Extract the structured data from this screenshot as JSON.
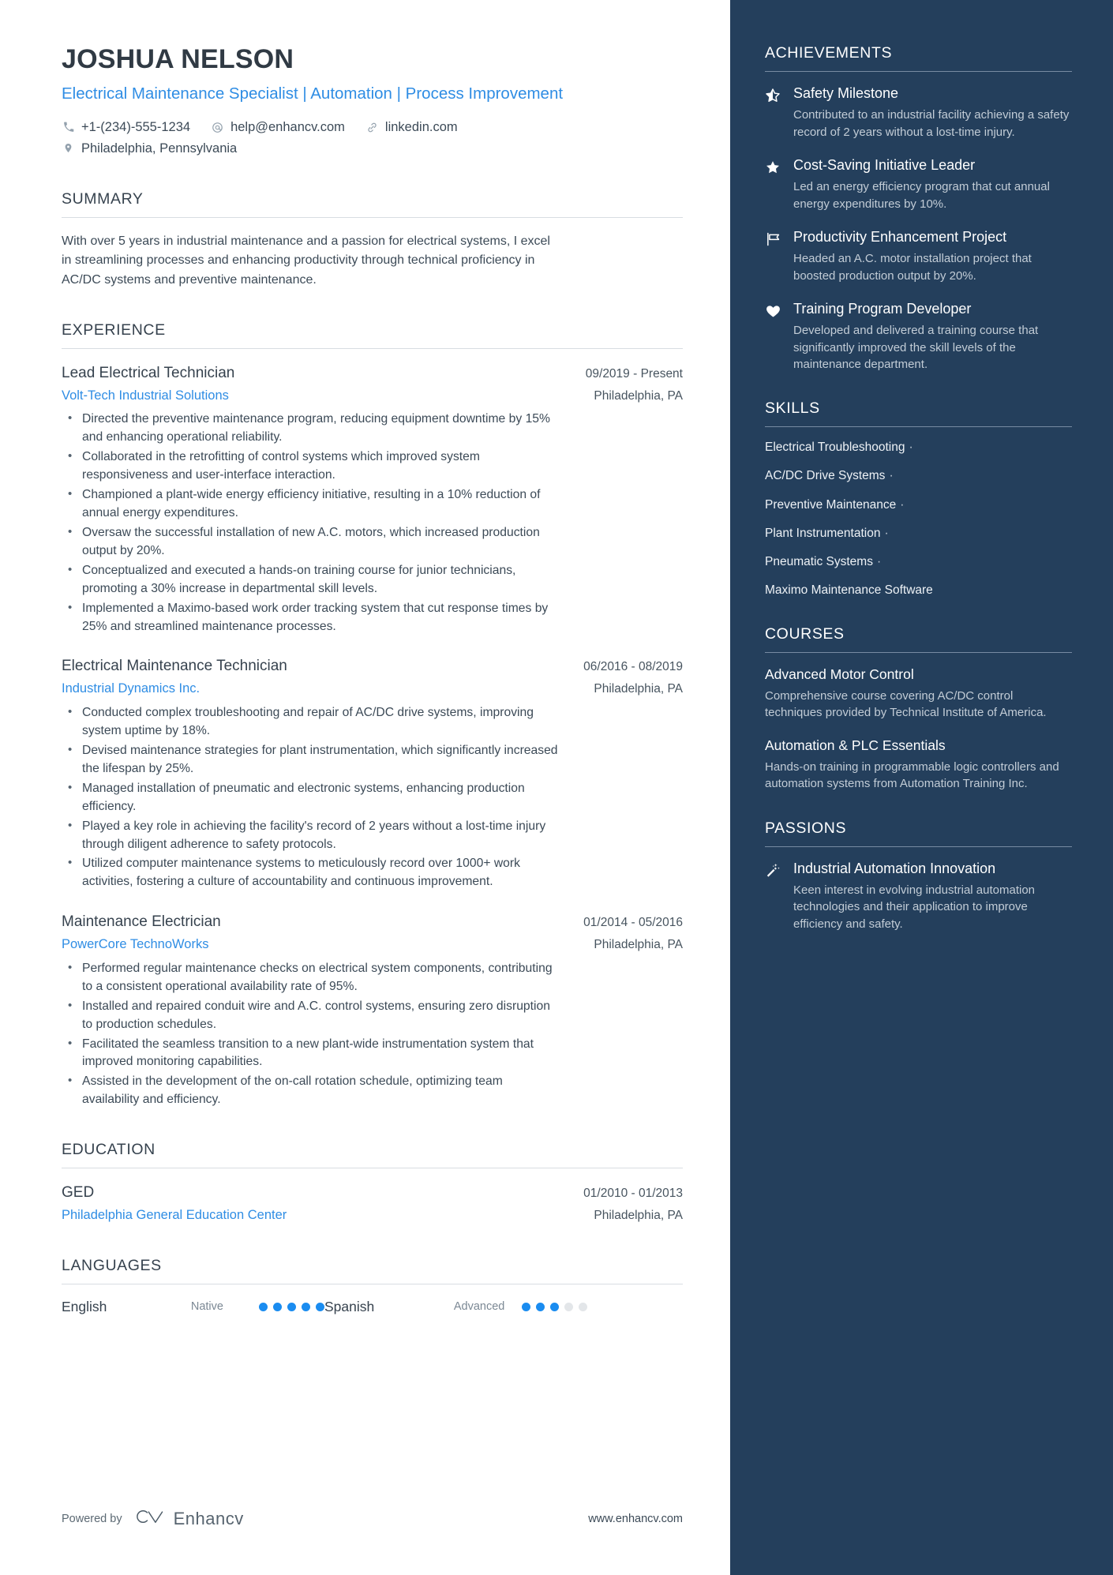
{
  "header": {
    "name": "JOSHUA NELSON",
    "headline": "Electrical Maintenance Specialist | Automation | Process Improvement",
    "contacts": [
      {
        "icon": "phone-icon",
        "text": "+1-(234)-555-1234"
      },
      {
        "icon": "email-icon",
        "text": "help@enhancv.com"
      },
      {
        "icon": "link-icon",
        "text": "linkedin.com"
      },
      {
        "icon": "location-icon",
        "text": "Philadelphia, Pennsylvania"
      }
    ]
  },
  "summary": {
    "title": "SUMMARY",
    "text": "With over 5 years in industrial maintenance and a passion for electrical systems, I excel in streamlining processes and enhancing productivity through technical proficiency in AC/DC systems and preventive maintenance."
  },
  "experience": {
    "title": "EXPERIENCE",
    "entries": [
      {
        "title": "Lead Electrical Technician",
        "date": "09/2019 - Present",
        "org": "Volt-Tech Industrial Solutions",
        "location": "Philadelphia, PA",
        "bullets": [
          "Directed the preventive maintenance program, reducing equipment downtime by 15% and enhancing operational reliability.",
          "Collaborated in the retrofitting of control systems which improved system responsiveness and user-interface interaction.",
          "Championed a plant-wide energy efficiency initiative, resulting in a 10% reduction of annual energy expenditures.",
          "Oversaw the successful installation of new A.C. motors, which increased production output by 20%.",
          "Conceptualized and executed a hands-on training course for junior technicians, promoting a 30% increase in departmental skill levels.",
          "Implemented a Maximo-based work order tracking system that cut response times by 25% and streamlined maintenance processes."
        ]
      },
      {
        "title": "Electrical Maintenance Technician",
        "date": "06/2016 - 08/2019",
        "org": "Industrial Dynamics Inc.",
        "location": "Philadelphia, PA",
        "bullets": [
          "Conducted complex troubleshooting and repair of AC/DC drive systems, improving system uptime by 18%.",
          "Devised maintenance strategies for plant instrumentation, which significantly increased the lifespan by 25%.",
          "Managed installation of pneumatic and electronic systems, enhancing production efficiency.",
          "Played a key role in achieving the facility's record of 2 years without a lost-time injury through diligent adherence to safety protocols.",
          "Utilized computer maintenance systems to meticulously record over 1000+ work activities, fostering a culture of accountability and continuous improvement."
        ]
      },
      {
        "title": "Maintenance Electrician",
        "date": "01/2014 - 05/2016",
        "org": "PowerCore TechnoWorks",
        "location": "Philadelphia, PA",
        "bullets": [
          "Performed regular maintenance checks on electrical system components, contributing to a consistent operational availability rate of 95%.",
          "Installed and repaired conduit wire and A.C. control systems, ensuring zero disruption to production schedules.",
          "Facilitated the seamless transition to a new plant-wide instrumentation system that improved monitoring capabilities.",
          "Assisted in the development of the on-call rotation schedule, optimizing team availability and efficiency."
        ]
      }
    ]
  },
  "education": {
    "title": "EDUCATION",
    "entries": [
      {
        "title": "GED",
        "date": "01/2010 - 01/2013",
        "org": "Philadelphia General Education Center",
        "location": "Philadelphia, PA"
      }
    ]
  },
  "languages": {
    "title": "LANGUAGES",
    "items": [
      {
        "name": "English",
        "level": "Native",
        "filled": 5,
        "total": 5
      },
      {
        "name": "Spanish",
        "level": "Advanced",
        "filled": 3,
        "total": 5
      }
    ]
  },
  "achievements": {
    "title": "ACHIEVEMENTS",
    "items": [
      {
        "icon": "star-half-icon",
        "title": "Safety Milestone",
        "desc": "Contributed to an industrial facility achieving a safety record of 2 years without a lost-time injury."
      },
      {
        "icon": "star-icon",
        "title": "Cost-Saving Initiative Leader",
        "desc": "Led an energy efficiency program that cut annual energy expenditures by 10%."
      },
      {
        "icon": "flag-icon",
        "title": "Productivity Enhancement Project",
        "desc": "Headed an A.C. motor installation project that boosted production output by 20%."
      },
      {
        "icon": "heart-icon",
        "title": "Training Program Developer",
        "desc": "Developed and delivered a training course that significantly improved the skill levels of the maintenance department."
      }
    ]
  },
  "skills": {
    "title": "SKILLS",
    "items": [
      {
        "name": "Electrical Troubleshooting",
        "sep": "·"
      },
      {
        "name": "AC/DC Drive Systems",
        "sep": "·"
      },
      {
        "name": "Preventive Maintenance",
        "sep": "·"
      },
      {
        "name": "Plant Instrumentation",
        "sep": "·"
      },
      {
        "name": "Pneumatic Systems",
        "sep": "·"
      },
      {
        "name": "Maximo Maintenance Software",
        "sep": ""
      }
    ]
  },
  "courses": {
    "title": "COURSES",
    "items": [
      {
        "title": "Advanced Motor Control",
        "desc": "Comprehensive course covering AC/DC control techniques provided by Technical Institute of America."
      },
      {
        "title": "Automation & PLC Essentials",
        "desc": "Hands-on training in programmable logic controllers and automation systems from Automation Training Inc."
      }
    ]
  },
  "passions": {
    "title": "PASSIONS",
    "items": [
      {
        "icon": "magic-wand-icon",
        "title": "Industrial Automation Innovation",
        "desc": "Keen interest in evolving industrial automation technologies and their application to improve efficiency and safety."
      }
    ]
  },
  "footer": {
    "powered_label": "Powered by",
    "brand": "Enhancv",
    "url": "www.enhancv.com"
  },
  "colors": {
    "accent_blue": "#2f8de4",
    "dot_blue": "#1a8cf0",
    "sidebar_bg": "#243f5c",
    "heading": "#36424e"
  }
}
